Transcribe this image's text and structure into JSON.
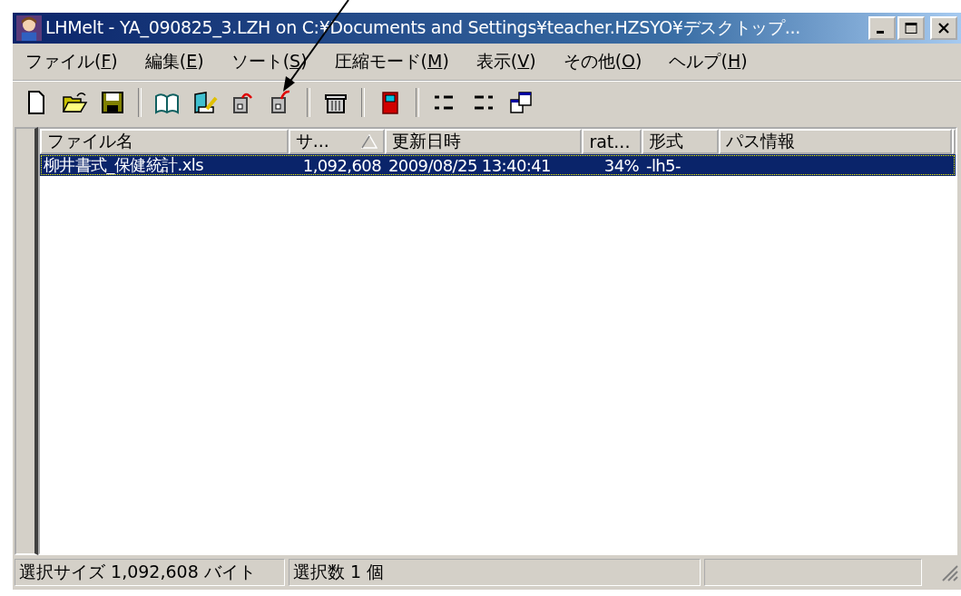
{
  "window": {
    "title": "LHMelt - YA_090825_3.LZH on C:¥Documents and Settings¥teacher.HZSYO¥デスクトップ..."
  },
  "menu": [
    "ファイル(F)",
    "編集(E)",
    "ソート(S)",
    "圧縮モード(M)",
    "表示(V)",
    "その他(O)",
    "ヘルプ(H)"
  ],
  "table": {
    "columns": [
      {
        "label": "ファイル名",
        "sorted": false
      },
      {
        "label": "サ...",
        "sorted": true
      },
      {
        "label": "更新日時",
        "sorted": false
      },
      {
        "label": "rat...",
        "sorted": false
      },
      {
        "label": "形式",
        "sorted": false
      },
      {
        "label": "パス情報",
        "sorted": false
      }
    ],
    "rows": [
      {
        "selected": true,
        "cells": [
          "柳井書式_保健統計.xls",
          "1,092,608",
          "2009/08/25 13:40:41",
          "34%",
          "-lh5-",
          ""
        ]
      }
    ]
  },
  "status_bar": [
    "選択サイズ 1,092,608 バイト",
    "選択数  1 個"
  ]
}
